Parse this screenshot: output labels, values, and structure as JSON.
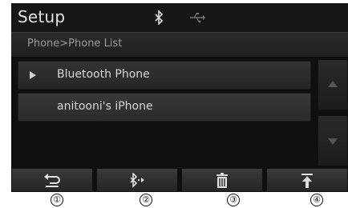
{
  "header": {
    "title": "Setup",
    "bluetooth_icon": "bluetooth-icon",
    "usb_icon": "usb-icon"
  },
  "breadcrumb": {
    "text": "Phone>Phone List"
  },
  "list": {
    "items": [
      {
        "label": "Bluetooth Phone",
        "icon": "play-arrow-icon"
      },
      {
        "label": "anitooni's iPhone"
      }
    ]
  },
  "scroll": {
    "up_icon": "scroll-up-icon",
    "down_icon": "scroll-down-icon"
  },
  "toolbar": {
    "buttons": [
      {
        "icon": "back-icon"
      },
      {
        "icon": "bluetooth-connect-icon"
      },
      {
        "icon": "trash-icon"
      },
      {
        "icon": "move-to-top-icon"
      }
    ]
  },
  "callouts": [
    "①",
    "②",
    "③",
    "④"
  ]
}
